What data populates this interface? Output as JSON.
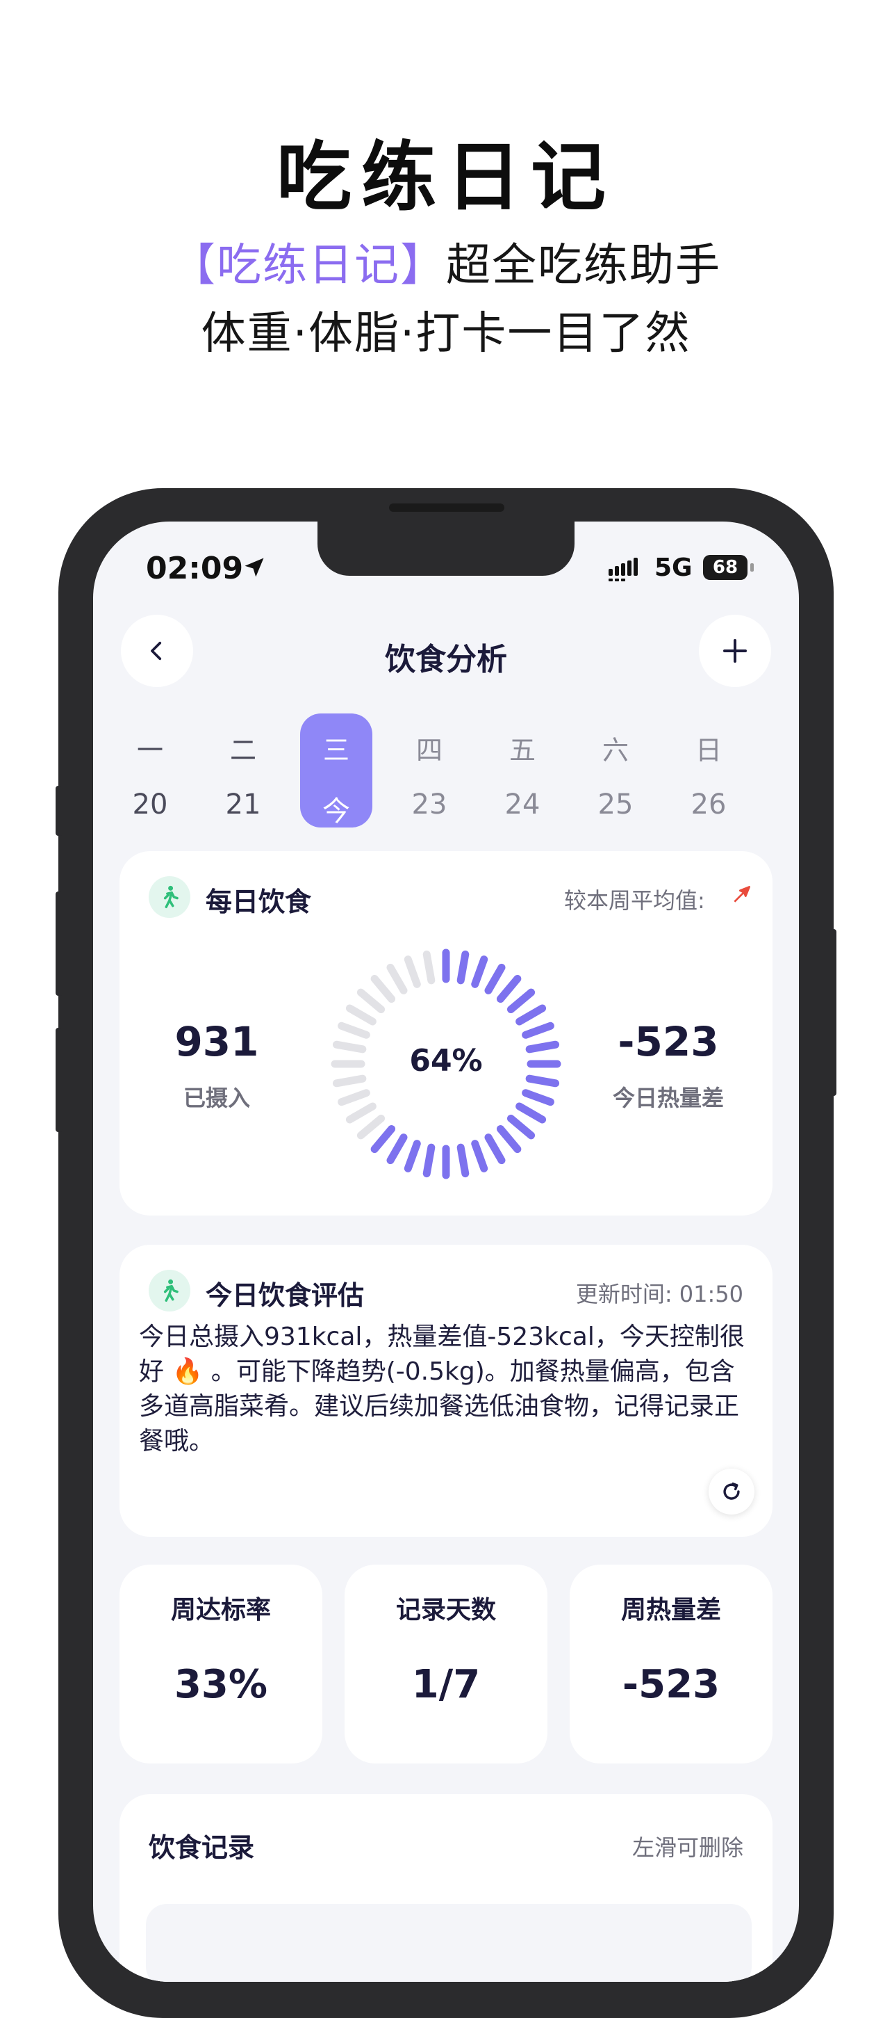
{
  "promo": {
    "title": "吃练日记",
    "line1_accent": "【吃练日记】",
    "line1_rest": "超全吃练助手",
    "line2": "体重·体脂·打卡一目了然"
  },
  "status_bar": {
    "time": "02:09",
    "network": "5G",
    "battery": "68"
  },
  "nav": {
    "title": "饮食分析"
  },
  "week": [
    {
      "name": "一",
      "num": "20",
      "state": "normal"
    },
    {
      "name": "二",
      "num": "21",
      "state": "normal"
    },
    {
      "name": "三",
      "num": "今",
      "state": "active"
    },
    {
      "name": "四",
      "num": "23",
      "state": "inactive"
    },
    {
      "name": "五",
      "num": "24",
      "state": "inactive"
    },
    {
      "name": "六",
      "num": "25",
      "state": "inactive"
    },
    {
      "name": "日",
      "num": "26",
      "state": "inactive"
    }
  ],
  "daily_diet": {
    "title": "每日饮食",
    "compare_label": "较本周平均值:",
    "intake_value": "931",
    "intake_label": "已摄入",
    "ring_percent_text": "64%",
    "ring_fraction": 0.64,
    "ring_colors": {
      "filled": "#7d72ee",
      "empty": "#e2e2e6"
    },
    "deficit_value": "-523",
    "deficit_label": "今日热量差"
  },
  "evaluation": {
    "title": "今日饮食评估",
    "update_time": "更新时间: 01:50",
    "text": "今日总摄入931kcal，热量差值-523kcal，今天控制很好 🔥 。可能下降趋势(-0.5kg)。加餐热量偏高，包含多道高脂菜肴。建议后续加餐选低油食物，记得记录正餐哦。"
  },
  "stats": [
    {
      "label": "周达标率",
      "value": "33%"
    },
    {
      "label": "记录天数",
      "value": "1/7"
    },
    {
      "label": "周热量差",
      "value": "-523"
    }
  ],
  "records": {
    "title": "饮食记录",
    "hint": "左滑可删除"
  },
  "colors": {
    "accent": "#8b6cf0",
    "active_day": "#8f87f7",
    "icon_bg": "#e3f6ee",
    "icon_green": "#2fbf7a",
    "trend_up": "#e94b3c"
  },
  "icons": {
    "back": "chevron-left-icon",
    "add": "plus-icon",
    "card": "walking-person-icon",
    "trend": "arrow-up-icon",
    "refresh": "refresh-icon",
    "location": "location-arrow-icon"
  }
}
